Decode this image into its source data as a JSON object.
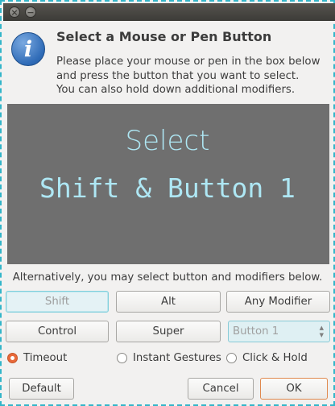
{
  "window": {
    "close_glyph": "×",
    "minimize_glyph": "−"
  },
  "dialog": {
    "icon_glyph": "i",
    "title": "Select a Mouse or Pen Button",
    "description_lines": [
      "Please place your mouse or pen in the box below",
      "and press the button that you want to select.",
      "You can also hold down additional modifiers."
    ]
  },
  "capture_area": {
    "prompt": "Select",
    "current": "Shift & Button 1",
    "text_color": "#aee7f4",
    "background": "#6f6f6f"
  },
  "alternative_text": "Alternatively, you may select button and modifiers below.",
  "modifiers": {
    "shift": "Shift",
    "alt": "Alt",
    "any": "Any Modifier",
    "control": "Control",
    "super": "Super"
  },
  "button_select": {
    "value": "Button 1",
    "up": "▲",
    "down": "▼"
  },
  "options": {
    "timeout": "Timeout",
    "instant": "Instant Gestures",
    "click_hold": "Click & Hold",
    "selected": "timeout"
  },
  "actions": {
    "default": "Default",
    "cancel": "Cancel",
    "ok": "OK"
  },
  "colors": {
    "accent": "#33b5c9",
    "radio_on": "#e8693a"
  }
}
